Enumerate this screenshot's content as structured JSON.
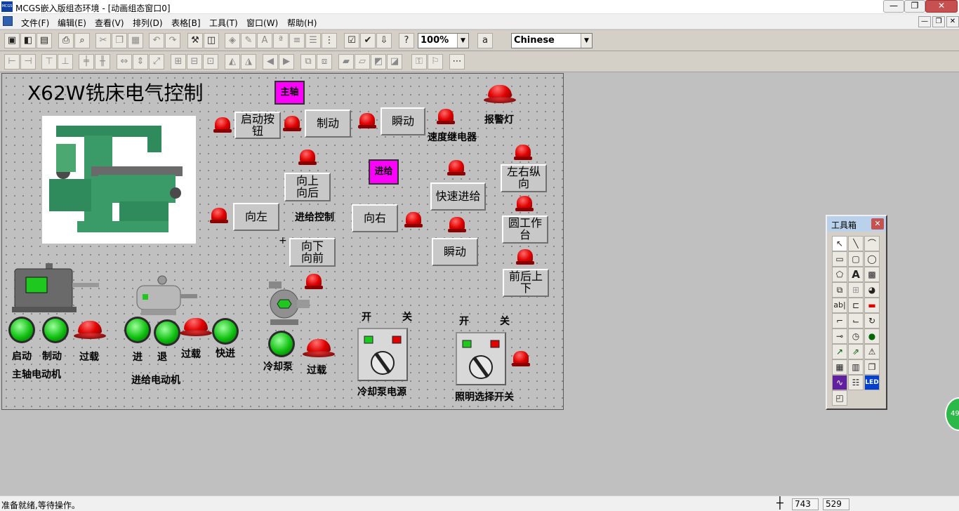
{
  "window": {
    "title": "MCGS嵌入版组态环境 - [动画组态窗口0]",
    "app_icon_text": "MCGS",
    "minimize": "—",
    "maximize": "❐",
    "close": "✕",
    "mdi_minimize": "—",
    "mdi_restore": "❐",
    "mdi_close": "✕"
  },
  "menu": [
    "文件(F)",
    "编辑(E)",
    "查看(V)",
    "排列(D)",
    "表格[B]",
    "工具(T)",
    "窗口(W)",
    "帮助(H)"
  ],
  "toolbar": {
    "zoom": "100%",
    "language": "Chinese"
  },
  "canvas": {
    "main_title": "X62W铣床电气控制",
    "spindle_box": "主轴",
    "feed_box": "进给",
    "buttons": {
      "start": "启动按钮",
      "brake": "制动",
      "jog_top": "瞬动",
      "up_back": "向上\n向后",
      "left": "向左",
      "down_front": "向下\n向前",
      "right": "向右",
      "rapid": "快速进给",
      "jog_mid": "瞬动",
      "lr_long": "左右纵向",
      "round_table": "圆工作台",
      "fb_ud": "前后上下"
    },
    "labels": {
      "alarm_light": "报警灯",
      "speed_relay": "速度继电器",
      "feed_control": "进给控制",
      "spindle_start": "启动",
      "spindle_brake": "制动",
      "spindle_overload": "过载",
      "spindle_motor": "主轴电动机",
      "feed_in": "进",
      "feed_out": "退",
      "feed_overload": "过载",
      "feed_fast": "快进",
      "feed_motor": "进给电动机",
      "coolant_pump": "冷却泵",
      "coolant_overload": "过载",
      "coolant_on": "开",
      "coolant_off": "关",
      "coolant_power": "冷却泵电源",
      "light_on": "开",
      "light_off": "关",
      "light_switch": "照明选择开关",
      "plus": "+"
    }
  },
  "toolbox": {
    "title": "工具箱",
    "close": "✕"
  },
  "status": {
    "text": "准备就绪,等待操作。",
    "x": "743",
    "y": "529"
  },
  "side_badge": "49"
}
